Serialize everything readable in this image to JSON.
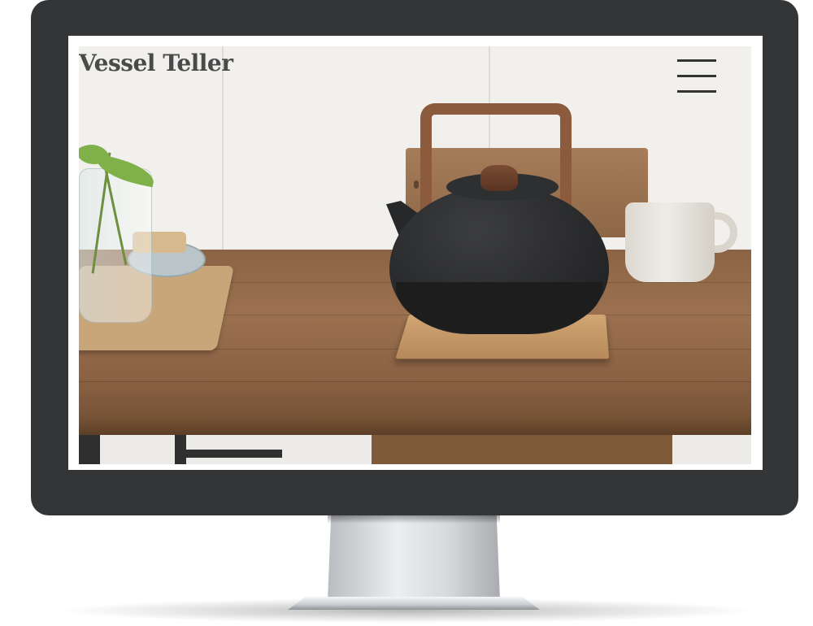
{
  "site": {
    "title": "Vessel Teller"
  },
  "header": {
    "menu_icon": "hamburger-menu-icon"
  },
  "hero": {
    "image_subject": "cast-iron-teapot-on-wooden-table"
  },
  "colors": {
    "monitor_bezel": "#343536",
    "title_text": "#4a4a4a",
    "menu_icon": "#333333"
  }
}
